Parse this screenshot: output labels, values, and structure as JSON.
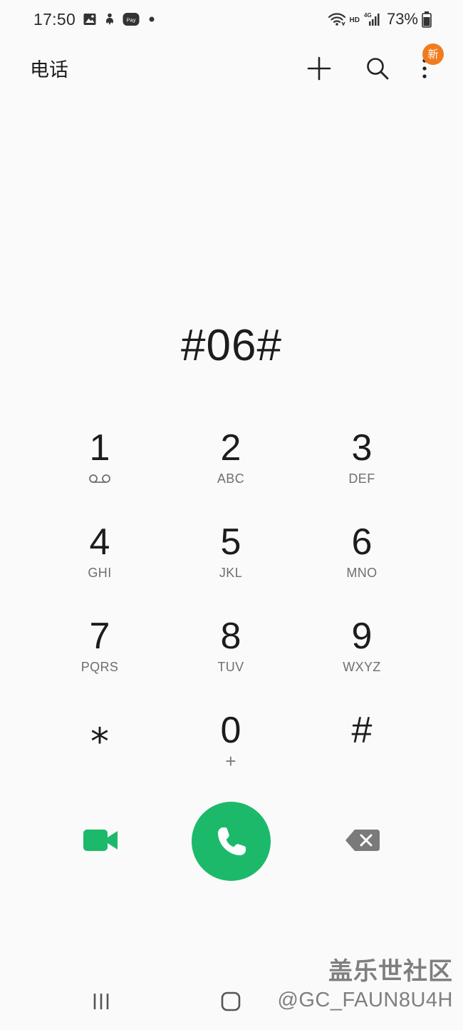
{
  "status_bar": {
    "time": "17:50",
    "left_icons": [
      "gallery-icon",
      "accessibility-icon",
      "pay-icon",
      "dot-icon"
    ],
    "pay_label": "Pay",
    "network_hd": "HD",
    "network_type": "4G",
    "battery": "73%"
  },
  "app_bar": {
    "title": "电话",
    "badge": "新",
    "actions": [
      "add-icon",
      "search-icon",
      "more-vert-icon"
    ]
  },
  "dialer": {
    "input_value": "#06#"
  },
  "keypad": [
    {
      "digit": "1",
      "sub": "",
      "icon": "voicemail-icon"
    },
    {
      "digit": "2",
      "sub": "ABC"
    },
    {
      "digit": "3",
      "sub": "DEF"
    },
    {
      "digit": "4",
      "sub": "GHI"
    },
    {
      "digit": "5",
      "sub": "JKL"
    },
    {
      "digit": "6",
      "sub": "MNO"
    },
    {
      "digit": "7",
      "sub": "PQRS"
    },
    {
      "digit": "8",
      "sub": "TUV"
    },
    {
      "digit": "9",
      "sub": "WXYZ"
    },
    {
      "digit": "⁎",
      "sub": ""
    },
    {
      "digit": "0",
      "sub": "+"
    },
    {
      "digit": "#",
      "sub": ""
    }
  ],
  "actions": {
    "video_call_icon": "video-call-icon",
    "call_icon": "phone-icon",
    "backspace_icon": "backspace-icon",
    "call_color": "#1cb96a",
    "video_color": "#1cb96a"
  },
  "nav_bar": {
    "icons": [
      "recents-icon",
      "home-icon"
    ]
  },
  "watermark": {
    "line1": "盖乐世社区",
    "line2": "@GC_FAUN8U4H"
  }
}
